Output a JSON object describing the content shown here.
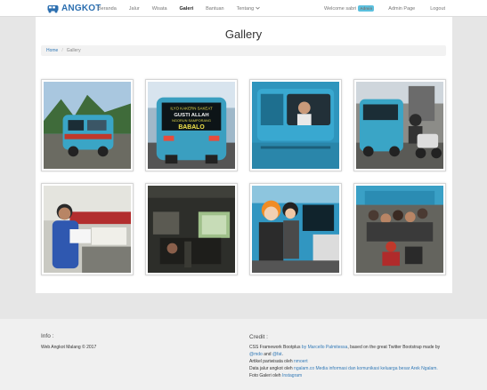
{
  "brand": {
    "name": "ANGKOT",
    "color": "#2c6fb0"
  },
  "nav": {
    "items": [
      {
        "label": "Beranda"
      },
      {
        "label": "Jalur"
      },
      {
        "label": "Wisata"
      },
      {
        "label": "Galeri",
        "active": true
      },
      {
        "label": "Bantuan"
      },
      {
        "label": "Tentang"
      }
    ],
    "welcome": "Welcome sabri",
    "badge": "Admin",
    "admin_page": "Admin Page",
    "logout": "Logout"
  },
  "page": {
    "title": "Gallery"
  },
  "breadcrumb": {
    "home": "Home",
    "current": "Gallery"
  },
  "gallery": {
    "images": [
      {
        "subject": "blue angkot on mountain road"
      },
      {
        "subject": "rear of angkot with sign board"
      },
      {
        "subject": "angkot side window with driver"
      },
      {
        "subject": "angkot in traffic with motorbike"
      },
      {
        "subject": "passenger reading inside angkot"
      },
      {
        "subject": "interior of angkot"
      },
      {
        "subject": "people in costumes at angkot"
      },
      {
        "subject": "group photo at angkot"
      }
    ],
    "sign_lines": [
      "ILYO KAKERN SAKEAT",
      "GUSTI ALLAH",
      "NGORUN SAMPORANG",
      "BABALO"
    ]
  },
  "footer": {
    "info_title": "Info :",
    "info_text": "Web Angkot Malang © 2017",
    "credit_title": "Credit :",
    "credit_line1_a": "CSS Framework Bootplus ",
    "credit_line1_link": "by Marcello Palmitessa",
    "credit_line1_b": ", based on the great Twitter Bootstrap made by",
    "credit_line2_link1": "@mdo",
    "credit_line2_and": " and ",
    "credit_line2_link2": "@fat",
    "credit_line2_end": ".",
    "credit_line3_a": "Artikel pariwisata oleh ",
    "credit_line3_link": "nmoert",
    "credit_line4_a": "Data jalur angkot oleh ",
    "credit_line4_link": "ngalam.co Media informasi dan komunikasi keluarga besar Arek Ngalam.",
    "credit_line5_a": "Foto Galeri oleh ",
    "credit_line5_link": "Instagram"
  }
}
